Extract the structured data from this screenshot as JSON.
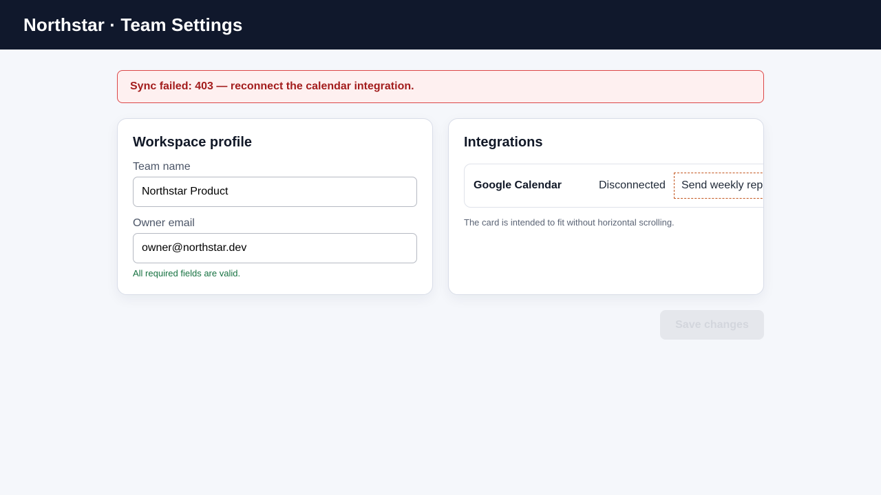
{
  "header": {
    "title": "Northstar · Team Settings"
  },
  "alert": {
    "message": "Sync failed: 403 — reconnect the calendar integration."
  },
  "profile_card": {
    "title": "Workspace profile",
    "team_name_label": "Team name",
    "team_name_value": "Northstar Product",
    "owner_email_label": "Owner email",
    "owner_email_value": "owner@northstar.dev",
    "validation_message": "All required fields are valid."
  },
  "integrations_card": {
    "title": "Integrations",
    "items": [
      {
        "name": "Google Calendar",
        "status": "Disconnected",
        "action_label": "Send weekly report"
      }
    ],
    "note": "The card is intended to fit without horizontal scrolling."
  },
  "footer": {
    "save_label": "Save changes"
  },
  "colors": {
    "header_bg": "#10182c",
    "alert_bg": "#fef0f0",
    "alert_border": "#dc4646",
    "alert_text": "#a31d1d",
    "success_text": "#157140",
    "toggle_border": "#c2541c",
    "disabled_button_bg": "#e5e7ec"
  }
}
